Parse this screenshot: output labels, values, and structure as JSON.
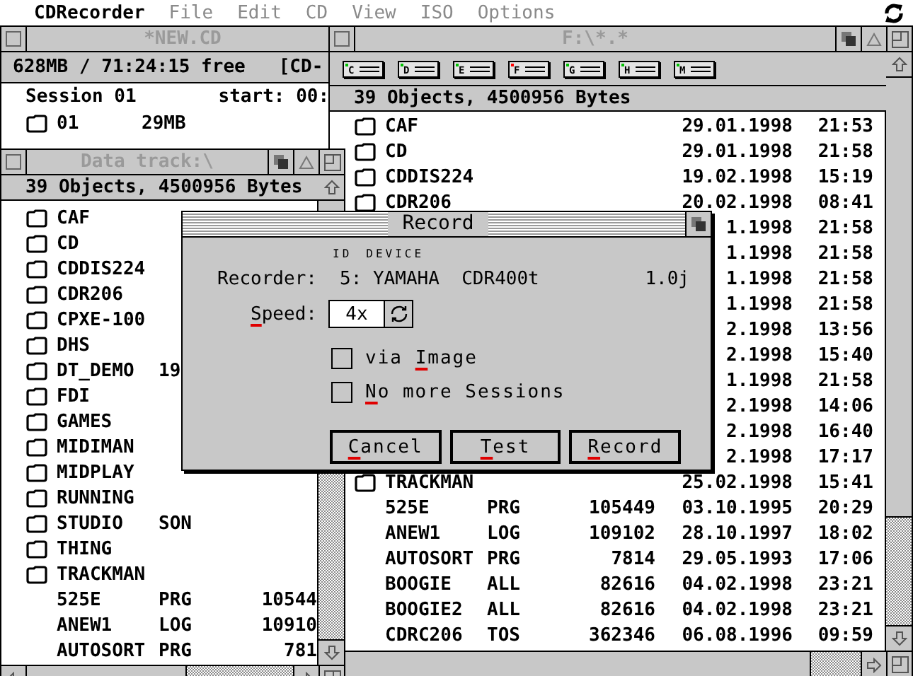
{
  "menu_bar": {
    "app_name": "CDRecorder",
    "items": [
      {
        "label": "File",
        "disabled": true
      },
      {
        "label": "Edit",
        "disabled": true
      },
      {
        "label": "CD",
        "disabled": true
      },
      {
        "label": "View",
        "disabled": true
      },
      {
        "label": "ISO",
        "disabled": true
      },
      {
        "label": "Options",
        "disabled": true
      }
    ]
  },
  "windows": [
    {
      "kind": "project",
      "title": "*NEW.CD",
      "info": "628MB / 71:24:15 free   [CD-",
      "session": {
        "label": "Session 01",
        "start": "start: 00:"
      },
      "tracks": [
        {
          "name": "01",
          "size": "29MB"
        }
      ]
    },
    {
      "kind": "browser",
      "title": "F:\\*.*",
      "drives": [
        {
          "letter": "C",
          "selected": false
        },
        {
          "letter": "D",
          "selected": false
        },
        {
          "letter": "E",
          "selected": false
        },
        {
          "letter": "F",
          "selected": true
        },
        {
          "letter": "G",
          "selected": false
        },
        {
          "letter": "H",
          "selected": false
        },
        {
          "letter": "M",
          "selected": false
        }
      ],
      "info": "39 Objects, 4500956 Bytes",
      "files": [
        {
          "kind": "folder",
          "name": "CAF",
          "date": "29.01.1998",
          "time": "21:53"
        },
        {
          "kind": "folder",
          "name": "CD",
          "date": "29.01.1998",
          "time": "21:58"
        },
        {
          "kind": "folder",
          "name": "CDDIS224",
          "date": "19.02.1998",
          "time": "15:19"
        },
        {
          "kind": "folder",
          "name": "CDR206",
          "date": "20.02.1998",
          "time": "08:41"
        },
        {
          "kind": "covered",
          "date": "1.1998",
          "time": "21:58"
        },
        {
          "kind": "covered",
          "date": "1.1998",
          "time": "21:58"
        },
        {
          "kind": "covered",
          "date": "1.1998",
          "time": "21:58"
        },
        {
          "kind": "covered",
          "date": "1.1998",
          "time": "21:58"
        },
        {
          "kind": "covered",
          "date": "2.1998",
          "time": "13:56"
        },
        {
          "kind": "covered",
          "date": "2.1998",
          "time": "15:40"
        },
        {
          "kind": "covered",
          "date": "1.1998",
          "time": "21:58"
        },
        {
          "kind": "covered",
          "date": "2.1998",
          "time": "14:06"
        },
        {
          "kind": "covered",
          "date": "2.1998",
          "time": "16:40"
        },
        {
          "kind": "covered",
          "date": "2.1998",
          "time": "17:17"
        },
        {
          "kind": "folder",
          "name": "TRACKMAN",
          "date": "25.02.1998",
          "time": "15:41"
        },
        {
          "kind": "file",
          "name": "525E",
          "ext": "PRG",
          "size": "105449",
          "date": "03.10.1995",
          "time": "20:29"
        },
        {
          "kind": "file",
          "name": "ANEW1",
          "ext": "LOG",
          "size": "109102",
          "date": "28.10.1997",
          "time": "18:02"
        },
        {
          "kind": "file",
          "name": "AUTOSORT",
          "ext": "PRG",
          "size": "7814",
          "date": "29.05.1993",
          "time": "17:06"
        },
        {
          "kind": "file",
          "name": "BOOGIE",
          "ext": "ALL",
          "size": "82616",
          "date": "04.02.1998",
          "time": "23:21"
        },
        {
          "kind": "file",
          "name": "BOOGIE2",
          "ext": "ALL",
          "size": "82616",
          "date": "04.02.1998",
          "time": "23:21"
        },
        {
          "kind": "file",
          "name": "CDRC206",
          "ext": "TOS",
          "size": "362346",
          "date": "06.08.1996",
          "time": "09:59"
        }
      ]
    },
    {
      "kind": "browser",
      "title": "Data track:\\",
      "info": "39 Objects, 4500956 Bytes",
      "files": [
        {
          "kind": "folder",
          "name": "CAF"
        },
        {
          "kind": "folder",
          "name": "CD"
        },
        {
          "kind": "folder",
          "name": "CDDIS224"
        },
        {
          "kind": "folder",
          "name": "CDR206"
        },
        {
          "kind": "folder",
          "name": "CPXE-100"
        },
        {
          "kind": "folder",
          "name": "DHS"
        },
        {
          "kind": "folder",
          "name": "DT_DEMO",
          "ext": "19"
        },
        {
          "kind": "folder",
          "name": "FDI"
        },
        {
          "kind": "folder",
          "name": "GAMES"
        },
        {
          "kind": "folder",
          "name": "MIDIMAN"
        },
        {
          "kind": "folder",
          "name": "MIDPLAY"
        },
        {
          "kind": "folder",
          "name": "RUNNING"
        },
        {
          "kind": "folder",
          "name": "STUDIO",
          "ext": "SON"
        },
        {
          "kind": "folder",
          "name": "THING"
        },
        {
          "kind": "folder",
          "name": "TRACKMAN"
        },
        {
          "kind": "file",
          "name": "525E",
          "ext": "PRG",
          "size": "10544"
        },
        {
          "kind": "file",
          "name": "ANEW1",
          "ext": "LOG",
          "size": "10910"
        },
        {
          "kind": "file",
          "name": "AUTOSORT",
          "ext": "PRG",
          "size": "781"
        }
      ]
    }
  ],
  "dialog": {
    "title": "Record",
    "column_headers": [
      "ID",
      "DEVICE"
    ],
    "recorder_label": "Recorder:",
    "recorder": "5: YAMAHA  CDR400t",
    "version": "1.0j",
    "speed": {
      "label": {
        "key": "S",
        "post": "peed:"
      },
      "value": "4x"
    },
    "options": [
      {
        "label": {
          "pre": "via ",
          "key": "I",
          "post": "mage"
        },
        "checked": false
      },
      {
        "label": {
          "key": "N",
          "post": "o more Sessions"
        },
        "checked": false
      }
    ],
    "buttons": [
      {
        "label": {
          "key": "C",
          "post": "ancel"
        }
      },
      {
        "label": {
          "key": "T",
          "post": "est"
        }
      },
      {
        "label": {
          "key": "R",
          "post": "ecord"
        }
      }
    ]
  }
}
